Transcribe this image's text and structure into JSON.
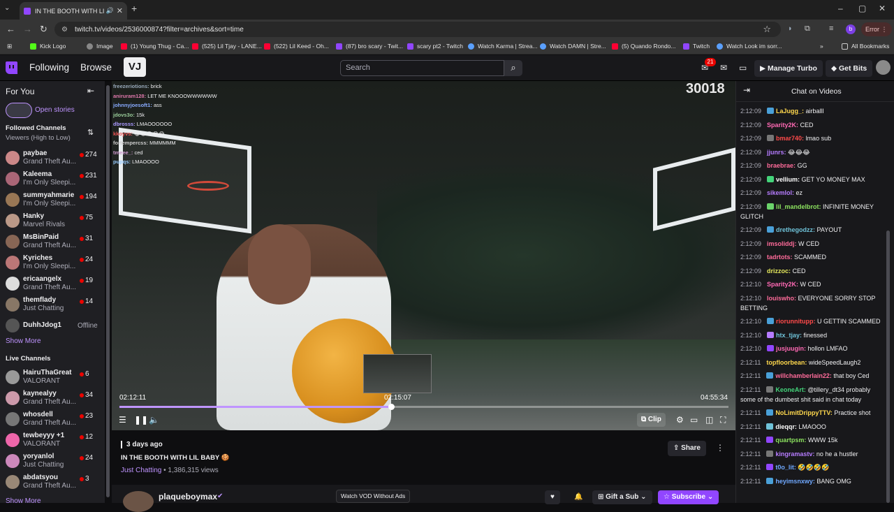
{
  "browser": {
    "tab_title": "IN THE BOOTH WITH LIL BA",
    "url": "twitch.tv/videos/2536000874?filter=archives&sort=time",
    "error_label": "Error",
    "profile_initial": "b",
    "bookmarks": [
      "Kick Logo",
      "Image",
      "(1) Young Thug - Ca...",
      "(525) Lil Tjay - LANE...",
      "(522) Lil Keed - Oh...",
      "(87) bro scary - Twit...",
      "scary pt2 - Twitch",
      "Watch Karma | Strea...",
      "Watch DAMN | Stre...",
      "(5) Quando Rondo...",
      "Twitch",
      "Watch Look im sorr..."
    ],
    "all_bookmarks": "All Bookmarks"
  },
  "topnav": {
    "following": "Following",
    "browse": "Browse",
    "logo_text": "VJ",
    "search_placeholder": "Search",
    "notif_count": "21",
    "manage_turbo": "Manage Turbo",
    "get_bits": "Get Bits"
  },
  "sidebar": {
    "for_you": "For You",
    "open_stories": "Open stories",
    "followed_heading": "Followed Channels",
    "followed_sort": "Viewers (High to Low)",
    "followed": [
      {
        "name": "paybae",
        "game": "Grand Theft Au...",
        "viewers": "274",
        "color": "#c88"
      },
      {
        "name": "Kaleema",
        "game": "I'm Only Sleepi...",
        "viewers": "231",
        "color": "#a67"
      },
      {
        "name": "summyahmarie",
        "game": "I'm Only Sleepi...",
        "viewers": "194",
        "color": "#975"
      },
      {
        "name": "Hanky",
        "game": "Marvel Rivals",
        "viewers": "75",
        "color": "#b98"
      },
      {
        "name": "MsBinPaid",
        "game": "Grand Theft Au...",
        "viewers": "31",
        "color": "#865"
      },
      {
        "name": "Kyriches",
        "game": "I'm Only Sleepi...",
        "viewers": "24",
        "color": "#b77"
      },
      {
        "name": "ericaangelx",
        "game": "Grand Theft Au...",
        "viewers": "19",
        "color": "#ddd"
      },
      {
        "name": "themflady",
        "game": "Just Chatting",
        "viewers": "14",
        "color": "#876"
      },
      {
        "name": "DuhhJdog1",
        "game": "",
        "viewers": "Offline",
        "color": "#555"
      }
    ],
    "show_more": "Show More",
    "live_heading": "Live Channels",
    "live": [
      {
        "name": "HairuThaGreat",
        "game": "VALORANT",
        "viewers": "6",
        "color": "#999"
      },
      {
        "name": "kaynealyy",
        "game": "Grand Theft Au...",
        "viewers": "34",
        "color": "#c9a"
      },
      {
        "name": "whosdell",
        "game": "Grand Theft Au...",
        "viewers": "23",
        "color": "#777"
      },
      {
        "name": "tewbeyyy +1",
        "game": "VALORANT",
        "viewers": "12",
        "color": "#e6a"
      },
      {
        "name": "yoryanlol",
        "game": "Just Chatting",
        "viewers": "24",
        "color": "#c8b"
      },
      {
        "name": "abdatsyou",
        "game": "Grand Theft Au...",
        "viewers": "3",
        "color": "#987"
      }
    ],
    "show_more_2": "Show More"
  },
  "video": {
    "viewer_count": "30018",
    "current_time": "02:12:11",
    "hover_time": "02:15:07",
    "duration": "04:55:34",
    "progress": 0.446,
    "clip_label": "Clip",
    "overlay_chat": [
      {
        "user": "freezeriotions:",
        "text": "brick",
        "color": "#9ab"
      },
      {
        "user": "aniruram128:",
        "text": "LET ME KNOOOWWWWWW",
        "color": "#d7a"
      },
      {
        "user": "johnnyjoesoft1:",
        "text": "ass",
        "color": "#8af"
      },
      {
        "user": "jdovs3o:",
        "text": "15k",
        "color": "#9c9"
      },
      {
        "user": "dbrosss:",
        "text": "LMAOOOOOO",
        "color": "#a9f"
      },
      {
        "user": "kkoyvs:",
        "text": "😂😂😂😂😂",
        "color": "#e55"
      },
      {
        "user": "fortempercss:",
        "text": "MMMMMM",
        "color": "#ccc"
      },
      {
        "user": "tmeee_:",
        "text": "ced",
        "color": "#c9c"
      },
      {
        "user": "pupqs:",
        "text": "LMAOOOO",
        "color": "#9cf"
      }
    ]
  },
  "info": {
    "ago": "3 days ago",
    "title": "IN THE BOOTH WITH LIL BABY 🍪",
    "category": "Just Chatting",
    "views": " • 1,386,315 views",
    "share": "Share",
    "channel": "plaqueboymax",
    "vod_ads": "Watch VOD Without Ads",
    "gift": "Gift a Sub",
    "subscribe": "Subscribe"
  },
  "chat": {
    "title": "Chat on Videos",
    "messages": [
      {
        "time": "2:12:09",
        "user": "LaJugg_:",
        "text": " airballl",
        "color": "#ffd84d",
        "badge": "#4aa0d8"
      },
      {
        "time": "2:12:09",
        "user": "Sparity2K:",
        "text": " CED",
        "color": "#ff69b4",
        "badge": ""
      },
      {
        "time": "2:12:09",
        "user": "bmar740:",
        "text": " lmao sub",
        "color": "#ff4a4a",
        "badge": "#777"
      },
      {
        "time": "2:12:09",
        "user": "jjunrs:",
        "text": " 😂😂😂",
        "color": "#b67cff",
        "badge": ""
      },
      {
        "time": "2:12:09",
        "user": "braebrae:",
        "text": " GG",
        "color": "#ff6b9a",
        "badge": ""
      },
      {
        "time": "2:12:09",
        "user": "vellium:",
        "text": " GET YO MONEY MAX",
        "color": "#ffffff",
        "badge": "#44d37a"
      },
      {
        "time": "2:12:09",
        "user": "sikemlol:",
        "text": " ez",
        "color": "#b67cff",
        "badge": ""
      },
      {
        "time": "2:12:09",
        "user": "lil_mandelbrot:",
        "text": " INFINITE MONEY GLITCH",
        "color": "#8ce35f",
        "badge": "#6bd36b"
      },
      {
        "time": "2:12:09",
        "user": "drethegodzz:",
        "text": " PAYOUT",
        "color": "#6fc2d8",
        "badge": "#4aa0d8"
      },
      {
        "time": "2:12:09",
        "user": "imsoliddj:",
        "text": " W CED",
        "color": "#ff6b9a",
        "badge": ""
      },
      {
        "time": "2:12:09",
        "user": "tadrtots:",
        "text": " SCAMMED",
        "color": "#ff6b9a",
        "badge": ""
      },
      {
        "time": "2:12:09",
        "user": "drizzoc:",
        "text": " CED",
        "color": "#e5e85c",
        "badge": ""
      },
      {
        "time": "2:12:10",
        "user": "Sparity2K:",
        "text": " W CED",
        "color": "#ff69b4",
        "badge": ""
      },
      {
        "time": "2:12:10",
        "user": "louiswho:",
        "text": " EVERYONE SORRY STOP BETTING",
        "color": "#ff6b9a",
        "badge": ""
      },
      {
        "time": "2:12:10",
        "user": "riorunnitupp:",
        "text": " U GETTIN SCAMMED",
        "color": "#ff4a4a",
        "badge": "#4aa0d8"
      },
      {
        "time": "2:12:10",
        "user": "htx_tjay:",
        "text": " finessed",
        "color": "#6fc2d8",
        "badge": "#b67cff"
      },
      {
        "time": "2:12:10",
        "user": "jusjuugin:",
        "text": " hollon LMFAO",
        "color": "#ff69b4",
        "badge": "#9146ff"
      },
      {
        "time": "2:12:11",
        "user": "topfloorbean:",
        "text": " wideSpeedLaugh2",
        "color": "#ffd84d",
        "badge": ""
      },
      {
        "time": "2:12:11",
        "user": "willchamberlain22:",
        "text": " that boy Ced",
        "color": "#ff6b9a",
        "badge": "#4aa0d8"
      },
      {
        "time": "2:12:11",
        "user": "KeoneArt:",
        "text": " @tillery_dt34 probably some of the dumbest shit said in chat today",
        "color": "#44d37a",
        "badge": "#777"
      },
      {
        "time": "2:12:11",
        "user": "NoLimitDrippyTTV:",
        "text": " Practice shot",
        "color": "#ffd84d",
        "badge": "#4aa0d8"
      },
      {
        "time": "2:12:11",
        "user": "dieqqr:",
        "text": " LMAOOO",
        "color": "#ffffff",
        "badge": "#6fc2d8"
      },
      {
        "time": "2:12:11",
        "user": "quartpsm:",
        "text": " WWW 15k",
        "color": "#8ce35f",
        "badge": "#9146ff"
      },
      {
        "time": "2:12:11",
        "user": "kingramastv:",
        "text": " no he a hustler",
        "color": "#b67cff",
        "badge": "#777"
      },
      {
        "time": "2:12:11",
        "user": "t0o_lit:",
        "text": " 🤣🤣🤣🤣",
        "color": "#6fa8ff",
        "badge": "#9146ff"
      },
      {
        "time": "2:12:11",
        "user": "heyimsnxwy:",
        "text": " BANG OMG",
        "color": "#6fa8ff",
        "badge": "#4aa0d8"
      }
    ]
  }
}
